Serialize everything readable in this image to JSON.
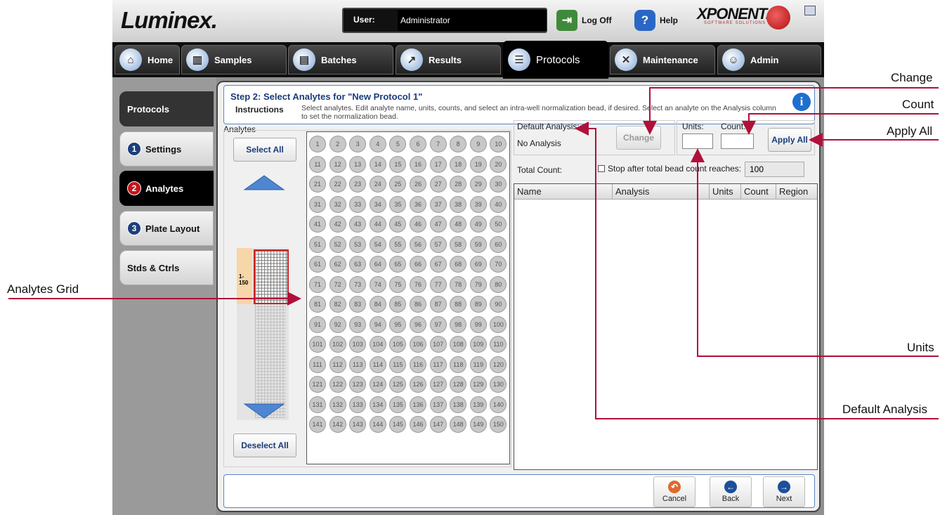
{
  "app": {
    "logo": "Luminex.",
    "user_label": "User:",
    "user_value": "Administrator",
    "logoff_label": "Log Off",
    "help_label": "Help",
    "brand": "XPONENT.",
    "brand_sub": "SOFTWARE SOLUTIONS"
  },
  "nav": {
    "tabs": [
      {
        "label": "Home",
        "icon": "home-icon"
      },
      {
        "label": "Samples",
        "icon": "samples-icon"
      },
      {
        "label": "Batches",
        "icon": "batches-icon"
      },
      {
        "label": "Results",
        "icon": "results-icon"
      },
      {
        "label": "Protocols",
        "icon": "protocols-icon"
      },
      {
        "label": "Maintenance",
        "icon": "maintenance-icon"
      },
      {
        "label": "Admin",
        "icon": "admin-icon"
      }
    ],
    "active": "Protocols"
  },
  "sidebar": {
    "items": [
      {
        "label": "Protocols",
        "num": ""
      },
      {
        "label": "Settings",
        "num": "1"
      },
      {
        "label": "Analytes",
        "num": "2"
      },
      {
        "label": "Plate Layout",
        "num": "3"
      },
      {
        "label": "Stds & Ctrls",
        "num": ""
      }
    ],
    "active": "Analytes"
  },
  "header": {
    "step": "Step 2: Select Analytes for \"New Protocol 1\"",
    "instructions_label": "Instructions",
    "instructions_text": "Select analytes. Edit analyte name, units, counts, and select an intra-well normalization bead, if desired. Select an analyte on the Analysis column to set the normalization bead."
  },
  "analytes": {
    "group_label": "Analytes",
    "select_all": "Select All",
    "deselect_all": "Deselect All",
    "range_label": "1-\n150",
    "count": 150
  },
  "defaults": {
    "default_analysis_label": "Default Analysis:",
    "default_analysis_value": "No Analysis",
    "change_label": "Change",
    "units_label": "Units:",
    "count_label": "Count:",
    "units_value": "",
    "count_value": "",
    "apply_all_label": "Apply All",
    "total_count_label": "Total Count:",
    "stop_label": "Stop after total bead count reaches:",
    "stop_value": "100"
  },
  "table": {
    "columns": [
      "Name",
      "Analysis",
      "Units",
      "Count",
      "Region"
    ]
  },
  "footer": {
    "cancel": "Cancel",
    "back": "Back",
    "next": "Next"
  },
  "callouts": {
    "change": "Change",
    "count": "Count",
    "apply_all": "Apply All",
    "analytes_grid": "Analytes Grid",
    "units": "Units",
    "default_analysis": "Default Analysis"
  },
  "colors": {
    "callout": "#b0103a",
    "accent_blue": "#1a3c7a",
    "active_step": "#c4161c"
  }
}
